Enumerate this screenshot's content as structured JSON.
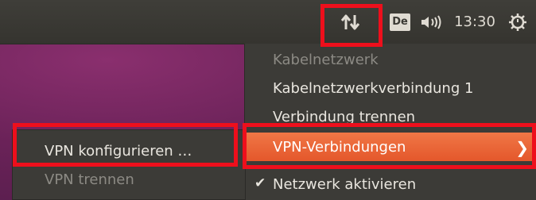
{
  "panel": {
    "network_icon": "network-updown-icon",
    "keyboard_layout": "De",
    "volume_icon": "speaker-volume-icon",
    "clock": "13:30",
    "power_icon": "gear-power-icon"
  },
  "network_menu": {
    "items": [
      {
        "label": "Kabelnetzwerk",
        "state": "disabled"
      },
      {
        "label": "Kabelnetzwerkverbindung 1",
        "state": "normal"
      },
      {
        "label": "Verbindung trennen",
        "state": "normal"
      },
      {
        "label": "VPN-Verbindungen",
        "state": "active",
        "submenu_icon": "chevron-right-icon"
      },
      {
        "label": "Netzwerk aktivieren",
        "state": "checked",
        "check_icon": "checkmark-icon"
      }
    ]
  },
  "vpn_submenu": {
    "items": [
      {
        "label": "VPN konfigurieren …",
        "state": "normal"
      },
      {
        "label": "VPN trennen",
        "state": "disabled"
      }
    ]
  },
  "colors": {
    "highlight_box": "#ee0f1c",
    "menu_active": "#e95420",
    "panel_bg": "#3c3b37"
  }
}
